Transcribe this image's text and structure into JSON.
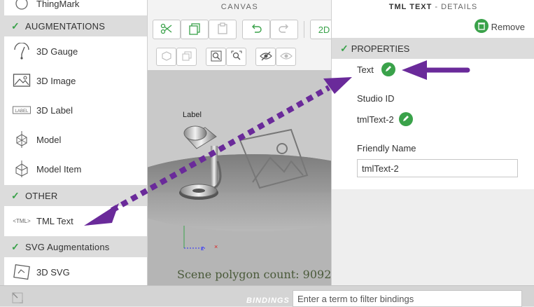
{
  "left_panel": {
    "top_item": "ThingMark",
    "sections": [
      {
        "title": "AUGMENTATIONS",
        "items": [
          "3D Gauge",
          "3D Image",
          "3D Label",
          "Model",
          "Model Item"
        ]
      },
      {
        "title": "OTHER",
        "items": [
          "TML Text"
        ]
      },
      {
        "title": "SVG Augmentations",
        "items": [
          "3D SVG"
        ]
      }
    ],
    "icons": [
      "gauge-icon",
      "image-icon",
      "label-icon",
      "model-icon",
      "model-item-icon",
      "tml-icon",
      "svg-icon"
    ],
    "tml_icon_text": "<TML>",
    "label_icon_text": "LABEL"
  },
  "canvas": {
    "title": "CANVAS",
    "mode_2d": "2D",
    "scene_label": "Label",
    "polygon_count": "Scene polygon count: 9092"
  },
  "details": {
    "title_bold": "TML TEXT",
    "title_rest": " - DETAILS",
    "remove_label": "Remove",
    "properties_header": "PROPERTIES",
    "text_label": "Text",
    "studio_id_label": "Studio ID",
    "studio_id_value": "tmlText-2",
    "friendly_name_label": "Friendly Name",
    "friendly_name_value": "tmlText-2"
  },
  "bindings": {
    "label": "BINDINGS",
    "placeholder": "Enter a term to filter bindings"
  },
  "colors": {
    "accent_green": "#3aa24a",
    "arrow_purple": "#6a2a9a",
    "section_gray": "#dcdcdc"
  }
}
